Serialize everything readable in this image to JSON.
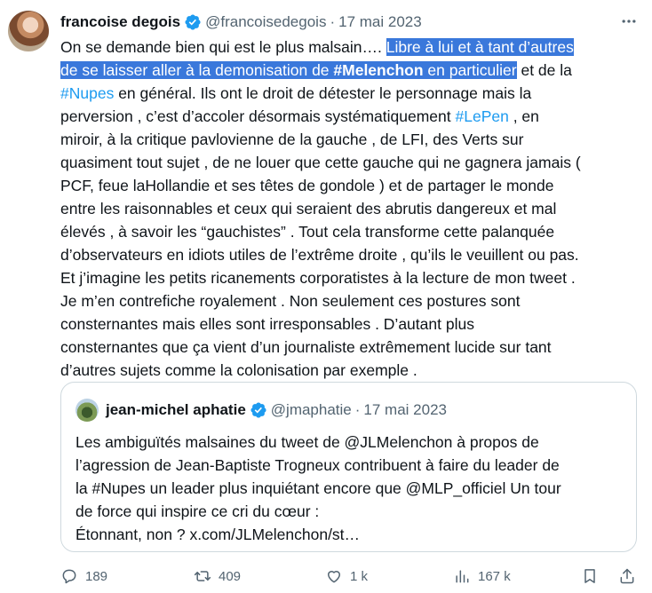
{
  "author": {
    "display_name": "francoise degois",
    "handle": "@francoisedegois",
    "separator": "·",
    "date": "17 mai 2023"
  },
  "body": {
    "l1_a": "On se demande bien qui est le plus malsain…. ",
    "l1_hl": "Libre à lui et à tant d’autres",
    "l2_hl_a": "de se laisser aller à la demonisation  de ",
    "l2_hl_tag": "#Melenchon",
    "l2_hl_b": " en particulier",
    "l2_b": " et de la",
    "l3_tag": "#Nupes",
    "l3_b": " en général. Ils ont le droit de détester le personnage  mais la",
    "l4_a": "perversion , c’est d’accoler  désormais systématiquement ",
    "l4_tag": "#LePen",
    "l4_b": " , en",
    "l5": "miroir,  à  la critique pavlovienne de la gauche , de LFI, des Verts  sur",
    "l6": "quasiment tout sujet  , de ne louer que cette gauche qui ne gagnera jamais (",
    "l7": "PCF, feue laHollandie et ses têtes de gondole ) et de partager le monde",
    "l8": "entre les raisonnables et ceux qui seraient des abrutis dangereux et mal",
    "l9": "élevés , à savoir les “gauchistes” . Tout  cela transforme cette palanquée",
    "l10": "d’observateurs en idiots utiles de l’extrême droite , qu’ils le veuillent ou pas.",
    "l11": "Et j’imagine les petits ricanements corporatistes à la lecture de  mon tweet .",
    "l12": "Je m’en contrefiche royalement . Non seulement ces postures sont",
    "l13": "consternantes  mais elles  sont irresponsables . D’autant plus",
    "l14": "consternantes que ça vient d’un journaliste extrêmement  lucide sur tant",
    "l15": "d’autres sujets comme la colonisation par exemple ."
  },
  "quote": {
    "display_name": "jean-michel aphatie",
    "handle": "@jmaphatie",
    "separator": "·",
    "date": "17 mai 2023",
    "l1": "Les ambiguïtés malsaines du tweet de @JLMelenchon à propos de",
    "l2": "l’agression de Jean-Baptiste Trogneux contribuent à faire du leader de",
    "l3": "la #Nupes un leader plus inquiétant encore que @MLP_officiel Un tour",
    "l4": "de force qui inspire ce cri du cœur :",
    "l5": "Étonnant, non ? x.com/JLMelenchon/st…"
  },
  "actions": {
    "replies": "189",
    "retweets": "409",
    "likes": "1 k",
    "views": "167 k"
  },
  "colors": {
    "accent": "#1d9bf0",
    "selection": "#3a78db",
    "muted": "#536471"
  }
}
